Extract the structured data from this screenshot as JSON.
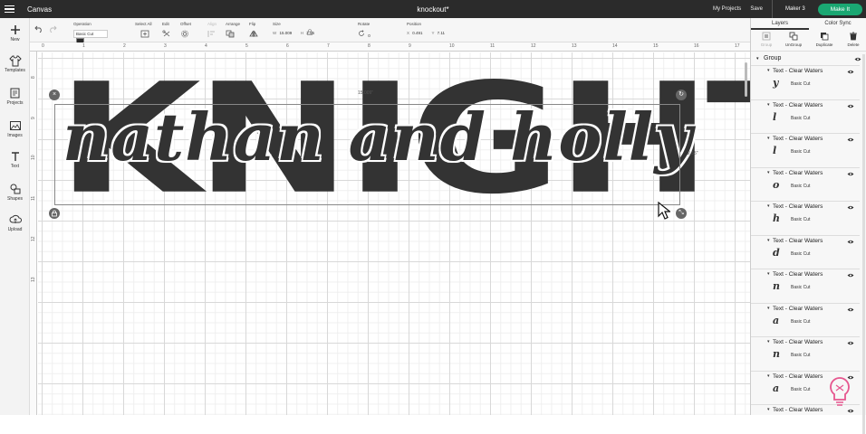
{
  "topbar": {
    "app_title": "Canvas",
    "document_title": "knockout*",
    "my_projects": "My Projects",
    "save": "Save",
    "machine": "Maker 3",
    "make_it": "Make It"
  },
  "leftbar": {
    "items": [
      {
        "label": "New",
        "icon": "plus-icon"
      },
      {
        "label": "Templates",
        "icon": "shirt-icon"
      },
      {
        "label": "Projects",
        "icon": "projects-icon"
      },
      {
        "label": "Images",
        "icon": "images-icon"
      },
      {
        "label": "Text",
        "icon": "text-icon"
      },
      {
        "label": "Shapes",
        "icon": "shapes-icon"
      },
      {
        "label": "Upload",
        "icon": "upload-icon"
      }
    ]
  },
  "toolbar": {
    "operation_label": "Operation",
    "operation_value": "Basic Cut",
    "select_all_label": "Select All",
    "edit_label": "Edit",
    "offset_label": "Offset",
    "align_label": "Align",
    "arrange_label": "Arrange",
    "flip_label": "Flip",
    "size_label": "Size",
    "size_w_prefix": "W",
    "size_w": "15.009",
    "size_h_prefix": "H",
    "size_h": "2.55",
    "rotate_label": "Rotate",
    "rotate_value": "0",
    "position_label": "Position",
    "pos_x_prefix": "X",
    "pos_x": "0.491",
    "pos_y_prefix": "Y",
    "pos_y": "7.11",
    "swatch_color": "#2a2a2a"
  },
  "canvas": {
    "ruler_top": [
      "0",
      "1",
      "2",
      "3",
      "4",
      "5",
      "6",
      "7",
      "8",
      "9",
      "10",
      "11",
      "12",
      "13",
      "14",
      "15",
      "16",
      "17"
    ],
    "ruler_left": [
      "8",
      "9",
      "10",
      "11",
      "12",
      "13"
    ],
    "width_dim": "15.009\"",
    "height_dim": "2.55\"",
    "knight_text": "KNIGHT",
    "script_text": "nathan and holly"
  },
  "rightpanel": {
    "tabs": [
      "Layers",
      "Color Sync"
    ],
    "actions": [
      "Group",
      "UnGroup",
      "Duplicate",
      "Delete"
    ],
    "group_name": "Group",
    "layers": [
      {
        "name": "Text - Clear Waters",
        "glyph": "y",
        "operation": "Basic Cut"
      },
      {
        "name": "Text - Clear Waters",
        "glyph": "l",
        "operation": "Basic Cut"
      },
      {
        "name": "Text - Clear Waters",
        "glyph": "l",
        "operation": "Basic Cut"
      },
      {
        "name": "Text - Clear Waters",
        "glyph": "o",
        "operation": "Basic Cut"
      },
      {
        "name": "Text - Clear Waters",
        "glyph": "h",
        "operation": "Basic Cut"
      },
      {
        "name": "Text - Clear Waters",
        "glyph": "d",
        "operation": "Basic Cut"
      },
      {
        "name": "Text - Clear Waters",
        "glyph": "n",
        "operation": "Basic Cut"
      },
      {
        "name": "Text - Clear Waters",
        "glyph": "a",
        "operation": "Basic Cut"
      },
      {
        "name": "Text - Clear Waters",
        "glyph": "n",
        "operation": "Basic Cut"
      },
      {
        "name": "Text - Clear Waters",
        "glyph": "a",
        "operation": "Basic Cut"
      },
      {
        "name": "Text - Clear Waters",
        "glyph": "",
        "operation": ""
      }
    ]
  },
  "colors": {
    "topbar_bg": "#2b2b2b",
    "make_it_bg": "#1aa772",
    "design_fill": "#333333"
  }
}
